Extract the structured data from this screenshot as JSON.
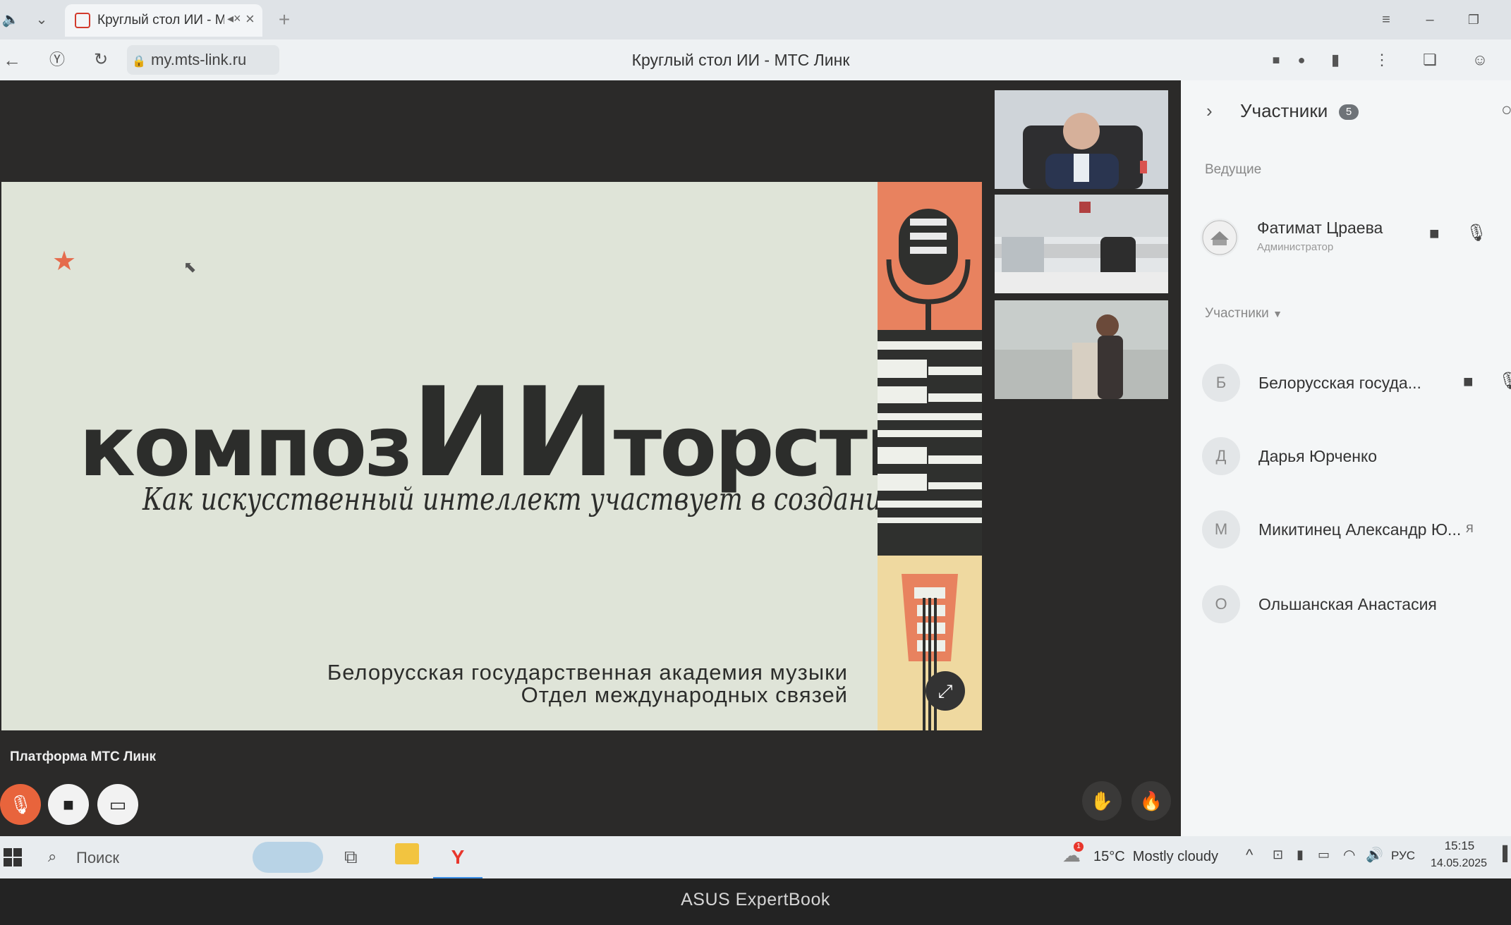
{
  "browser": {
    "tab_title": "Круглый стол ИИ - М",
    "url": "my.mts-link.ru",
    "page_title": "Круглый стол ИИ - МТС Линк"
  },
  "slide": {
    "title_part1": "композ",
    "title_part2": "ИИ",
    "title_part3": "торство",
    "subtitle": "Как искусственный интеллект участвует в создании музыки",
    "org_line1": "Белорусская государственная академия музыки",
    "org_line2": "Отдел международных связей"
  },
  "panel": {
    "title": "Участники",
    "count": "5",
    "hosts_label": "Ведущие",
    "host": {
      "name": "Фатимат Цраева",
      "role": "Администратор"
    },
    "participants_label": "Участники",
    "participants": [
      {
        "initial": "Б",
        "name": "Белорусская госуда..."
      },
      {
        "initial": "Д",
        "name": "Дарья Юрченко"
      },
      {
        "initial": "М",
        "name": "Микитинец Александр Ю...",
        "suffix": "я"
      },
      {
        "initial": "О",
        "name": "Ольшанская Анастасия"
      }
    ]
  },
  "stage": {
    "platform_label": "Платформа МТС Линк"
  },
  "taskbar": {
    "search_placeholder": "Поиск",
    "weather": "15°C  Mostly cloudy",
    "weather_badge": "1",
    "lang": "РУС",
    "time": "15:15",
    "date": "14.05.2025"
  },
  "device": {
    "brand": "ASUS ExpertBook"
  },
  "colors": {
    "accent_orange": "#e8825f",
    "mic_muted": "#e8643c",
    "slide_bg": "#dfe4d8"
  }
}
